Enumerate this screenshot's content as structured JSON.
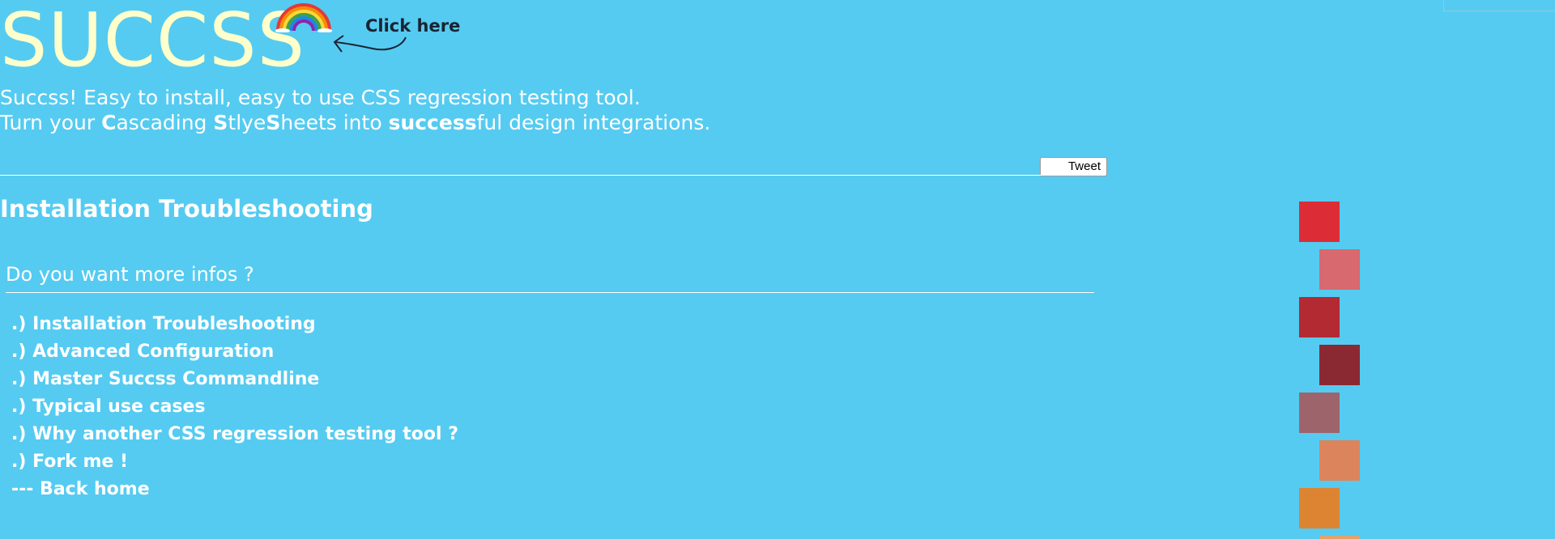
{
  "header": {
    "logo": "SUCCSS",
    "click_here": "Click here",
    "tagline_line1": "Succss! Easy to install, easy to use CSS regression testing tool.",
    "tagline_line2": {
      "p1": "Turn your ",
      "b1": "C",
      "p2": "ascading ",
      "b2": "S",
      "p3": "tlye",
      "b3": "S",
      "p4": "heets into ",
      "b4": "success",
      "p5": "ful design integrations."
    },
    "tweet_label": "Tweet"
  },
  "main": {
    "title": "Installation Troubleshooting",
    "info_heading": "Do you want more infos ?",
    "nav": [
      ".) Installation Troubleshooting",
      ".) Advanced Configuration",
      ".) Master Succss Commandline",
      ".) Typical use cases",
      ".) Why another CSS regression testing tool ?",
      ".) Fork me !",
      "--- Back home"
    ]
  },
  "colors": {
    "background": "#55cbf1",
    "logo": "#ffffcc",
    "swatches": [
      "#dc2d36",
      "#d8696e",
      "#b32a33",
      "#8b2933",
      "#9e646c",
      "#dc845c",
      "#dd8433",
      "#e0a36f"
    ]
  },
  "icons": {
    "rainbow": "rainbow-icon",
    "arrow": "curved-arrow-icon"
  }
}
